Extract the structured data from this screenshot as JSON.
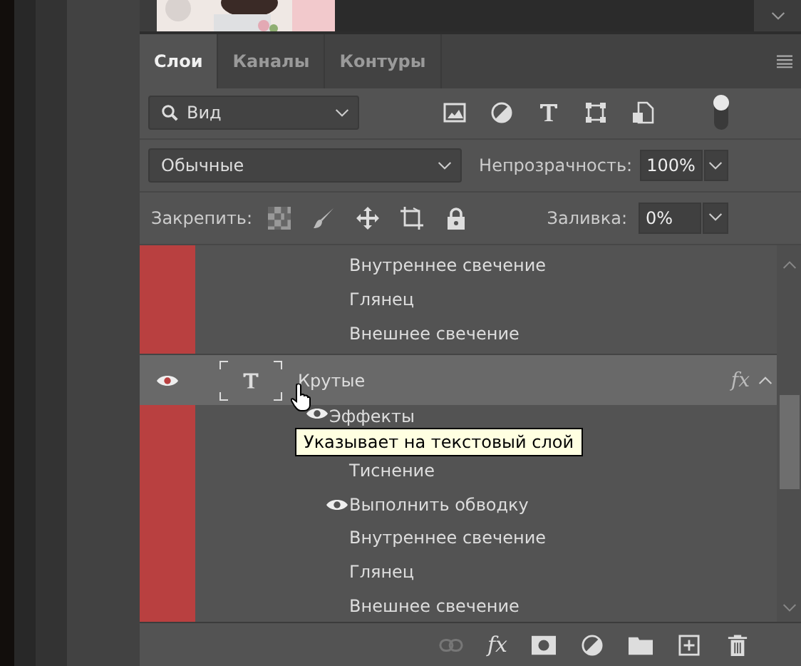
{
  "tabs": [
    {
      "label": "Слои",
      "selected": true
    },
    {
      "label": "Каналы",
      "selected": false
    },
    {
      "label": "Контуры",
      "selected": false
    }
  ],
  "filter": {
    "value": "Вид"
  },
  "blend_mode": {
    "value": "Обычные"
  },
  "opacity": {
    "label": "Непрозрачность:",
    "value": "100%"
  },
  "lock": {
    "label": "Закрепить:"
  },
  "fill": {
    "label": "Заливка:",
    "value": "0%"
  },
  "layers": [
    {
      "kind": "effect",
      "label": "Внутреннее свечение",
      "visible": false
    },
    {
      "kind": "effect",
      "label": "Глянец",
      "visible": false
    },
    {
      "kind": "effect",
      "label": "Внешнее свечение",
      "visible": false
    },
    {
      "kind": "layer",
      "name": "Крутые",
      "selected": true,
      "visible": true,
      "fx": "fx"
    },
    {
      "kind": "header",
      "label": "Эффекты",
      "visible": true
    },
    {
      "kind": "effect",
      "label": "Тиснение",
      "visible": false
    },
    {
      "kind": "effect",
      "label": "Выполнить обводку",
      "visible": true
    },
    {
      "kind": "effect",
      "label": "Внутреннее свечение",
      "visible": false
    },
    {
      "kind": "effect",
      "label": "Глянец",
      "visible": false
    },
    {
      "kind": "effect",
      "label": "Внешнее свечение",
      "visible": false
    }
  ],
  "tooltip": {
    "text": "Указывает на текстовый слой"
  },
  "bottom_toolbar": {
    "fx": "fx"
  }
}
